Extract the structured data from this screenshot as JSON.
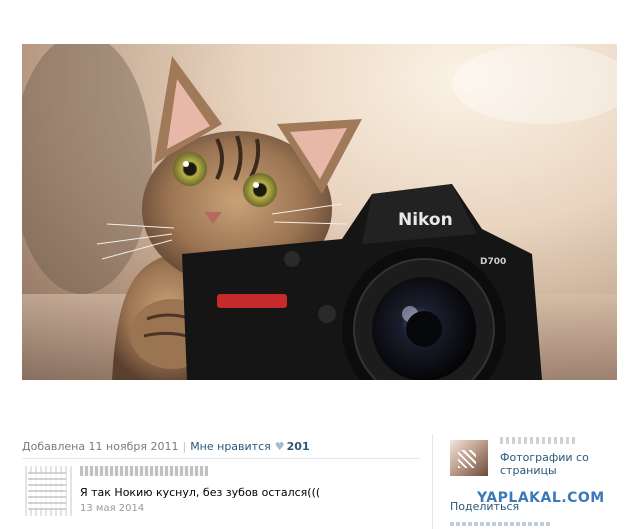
{
  "photo": {
    "camera_brand": "Nikon",
    "camera_model": "D700"
  },
  "meta": {
    "added": "Добавлена 11 ноября 2011",
    "likes_label": "Мне нравится",
    "heart": "♥",
    "likes_count": "201"
  },
  "comment": {
    "text": "Я так Нокию куснул, без зубов остался(((",
    "date": "13 мая 2014"
  },
  "sidebar": {
    "photos_link_line1": "Фотографии со",
    "photos_link_line2": "страницы",
    "share_label": "Поделиться"
  },
  "watermark": "YAPLAKAL.COM",
  "colors": {
    "link": "#2b587a",
    "meta_gray": "#7a7a7a",
    "watermark": "#3a7ab8"
  }
}
